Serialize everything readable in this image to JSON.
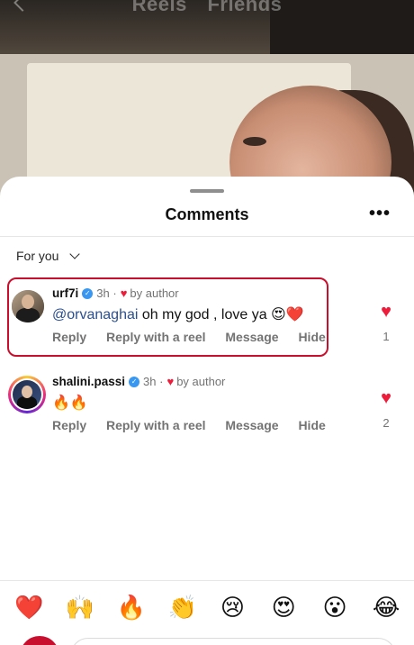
{
  "background": {
    "tabs": [
      "Reels",
      "Friends"
    ]
  },
  "sheet": {
    "title": "Comments",
    "filter_label": "For you"
  },
  "comments": [
    {
      "username": "urf7i",
      "time": "3h",
      "liked_by": "by author",
      "mention": "@orvanaghai",
      "text": " oh my god , love ya 😍❤️",
      "actions": [
        "Reply",
        "Reply with a reel",
        "Message",
        "Hide"
      ],
      "likes": "1",
      "highlighted": true
    },
    {
      "username": "shalini.passi",
      "time": "3h",
      "liked_by": "by author",
      "mention": "",
      "text": "🔥🔥",
      "actions": [
        "Reply",
        "Reply with a reel",
        "Message",
        "Hide"
      ],
      "likes": "2",
      "highlighted": false
    }
  ],
  "emoji_bar": [
    "❤️",
    "🙌",
    "🔥",
    "👏",
    "😢",
    "😍",
    "😮",
    "😂"
  ],
  "colors": {
    "like_red": "#ed1c3a",
    "highlight": "#c8102e",
    "verified": "#3897f0"
  },
  "icons": [
    "back-arrow-icon",
    "more-icon",
    "chevron-down-icon",
    "verified-icon",
    "heart-icon"
  ]
}
